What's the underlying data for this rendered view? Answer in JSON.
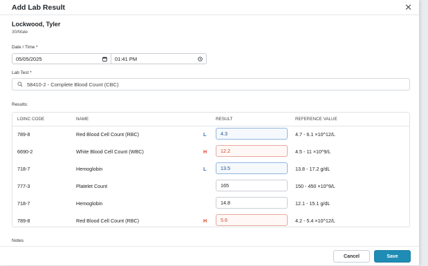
{
  "dialog": {
    "title": "Add Lab Result",
    "close_glyph": "✕"
  },
  "patient": {
    "name": "Lockwood, Tyler",
    "meta": "30/Male"
  },
  "datetime": {
    "label": "Date / Time *",
    "date_value": "05/05/2025",
    "time_value": "01:41 PM"
  },
  "lab_test": {
    "label": "Lab Test *",
    "value": "58410-2 - Complete Blood Count (CBC)"
  },
  "results": {
    "label": "Results:",
    "columns": {
      "loinc": "LOINC CODE",
      "name": "NAME",
      "result": "RESULT",
      "reference": "REFERENCE VALUE"
    },
    "rows": [
      {
        "code": "789-8",
        "name": "Red Blood Cell Count (RBC)",
        "flag": "L",
        "value": "4.3",
        "reference": "4.7 - 6.1 ×10^12/L"
      },
      {
        "code": "6690-2",
        "name": "White Blood Cell Count (WBC)",
        "flag": "H",
        "value": "12.2",
        "reference": "4.5 - 11 ×10^9/L"
      },
      {
        "code": "718-7",
        "name": "Hemoglobin",
        "flag": "L",
        "value": "13.5",
        "reference": "13.8 - 17.2 g/dL"
      },
      {
        "code": "777-3",
        "name": "Platelet Count",
        "flag": "",
        "value": "165",
        "reference": "150 - 450 ×10^9/L"
      },
      {
        "code": "718-7",
        "name": "Hemoglobin",
        "flag": "",
        "value": "14.8",
        "reference": "12.1 - 15.1 g/dL"
      },
      {
        "code": "789-8",
        "name": "Red Blood Cell Count (RBC)",
        "flag": "H",
        "value": "5.6",
        "reference": "4.2 - 5.4 ×10^12/L"
      }
    ]
  },
  "notes": {
    "label": "Notes"
  },
  "buttons": {
    "cancel": "Cancel",
    "save": "Save"
  },
  "colors": {
    "save": "#1f8cb5",
    "flag_low": "#2f6db3",
    "flag_high": "#d9432a"
  }
}
